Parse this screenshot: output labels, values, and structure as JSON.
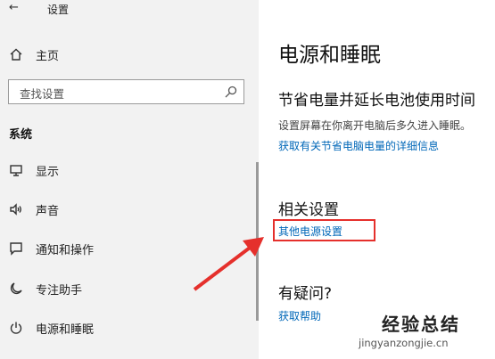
{
  "header": {
    "back_glyph": "←",
    "title": "设置"
  },
  "sidebar": {
    "home_label": "主页",
    "search_placeholder": "查找设置",
    "section_label": "系统",
    "items": [
      {
        "label": "显示",
        "icon": "monitor-icon"
      },
      {
        "label": "声音",
        "icon": "speaker-icon"
      },
      {
        "label": "通知和操作",
        "icon": "notification-icon"
      },
      {
        "label": "专注助手",
        "icon": "moon-icon"
      },
      {
        "label": "电源和睡眠",
        "icon": "power-icon"
      }
    ]
  },
  "main": {
    "title": "电源和睡眠",
    "subtitle": "节省电量并延长电池使用时间",
    "description": "设置屏幕在你离开电脑后多久进入睡眠。",
    "battery_link": "获取有关节省电脑电量的详细信息",
    "related_heading": "相关设置",
    "power_settings_link": "其他电源设置",
    "question_heading": "有疑问?",
    "help_link": "获取帮助"
  },
  "watermark": {
    "title": "经验总结",
    "url": "jingyanzongjie.cn"
  },
  "colors": {
    "link": "#0067b8",
    "highlight": "#e5302c",
    "sidebar_bg": "#f2f2f2"
  }
}
